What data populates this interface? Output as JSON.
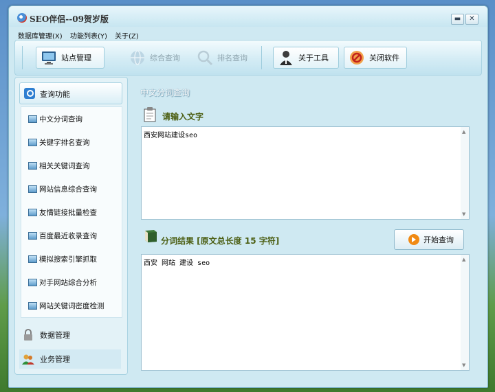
{
  "window": {
    "title": "SEO伴侣--09贺岁版"
  },
  "menu": [
    "数据库管理(X)",
    "功能列表(Y)",
    "关于(Z)"
  ],
  "toolbar": {
    "site_manage": "站点管理",
    "combined_query": "综合查询",
    "rank_query": "排名查询",
    "about_tool": "关于工具",
    "close_app": "关闭软件"
  },
  "sidebar": {
    "header": "查询功能",
    "items": [
      "中文分词查询",
      "关键字排名查询",
      "相关关键词查询",
      "网站信息综合查询",
      "友情链接批量检查",
      "百度最近收录查询",
      "模拟搜索引擎抓取",
      "对手网站综合分析",
      "网站关键词密度检测"
    ],
    "data_manage": "数据管理",
    "business_manage": "业务管理"
  },
  "main": {
    "section_title": "中文分词查询",
    "input_label": "请输入文字",
    "input_value": "西安网站建设seo",
    "result_label": "分词结果 [原文总长度 15 字符]",
    "start_button": "开始查询",
    "result_value": "西安 网站 建设 seo"
  }
}
